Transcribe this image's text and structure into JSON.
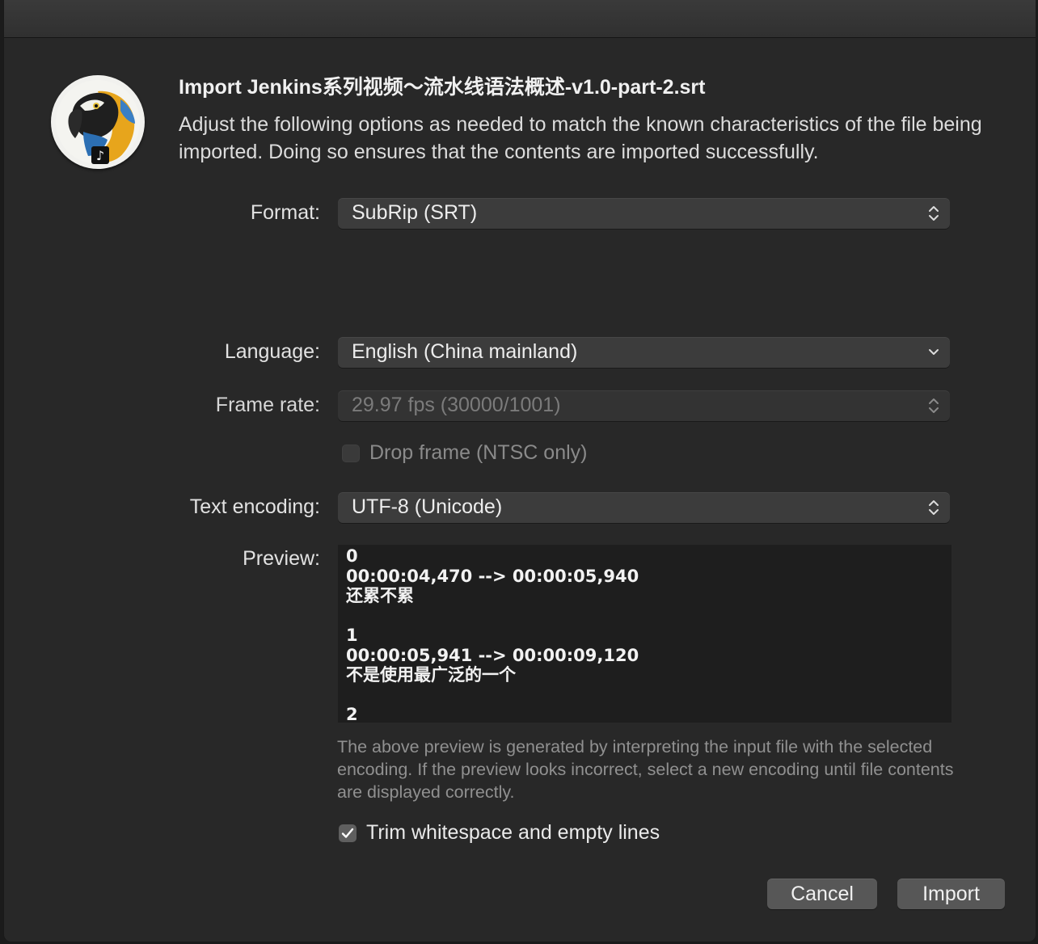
{
  "dialog": {
    "title": "Import Jenkins系列视频～流水线语法概述-v1.0-part-2.srt",
    "description": "Adjust the following options as needed to match the known characteristics of the file being imported. Doing so ensures that the contents are imported successfully."
  },
  "app_icon": "parrot-music-app-icon",
  "format": {
    "label": "Format:",
    "value": "SubRip (SRT)"
  },
  "language": {
    "label": "Language:",
    "value": "English (China mainland)"
  },
  "frame_rate": {
    "label": "Frame rate:",
    "value": "29.97 fps (30000/1001)",
    "enabled": false
  },
  "drop_frame": {
    "label": "Drop frame (NTSC only)",
    "checked": false,
    "enabled": false
  },
  "text_encoding": {
    "label": "Text encoding:",
    "value": "UTF-8 (Unicode)"
  },
  "preview": {
    "label": "Preview:",
    "content": "0\n00:00:04,470 --> 00:00:05,940\n还累不累\n\n1\n00:00:05,941 --> 00:00:09,120\n不是使用最广泛的一个\n\n2"
  },
  "preview_note": "The above preview is generated by interpreting the input file with the selected encoding. If the preview looks incorrect, select a new encoding until file contents are displayed correctly.",
  "trim": {
    "label": "Trim whitespace and empty lines",
    "checked": true
  },
  "buttons": {
    "cancel": "Cancel",
    "import": "Import"
  },
  "colors": {
    "sheet_bg": "#282828",
    "popup_bg": "#3c3c3c",
    "button_bg": "#575757",
    "preview_bg": "#1e1e1e"
  }
}
